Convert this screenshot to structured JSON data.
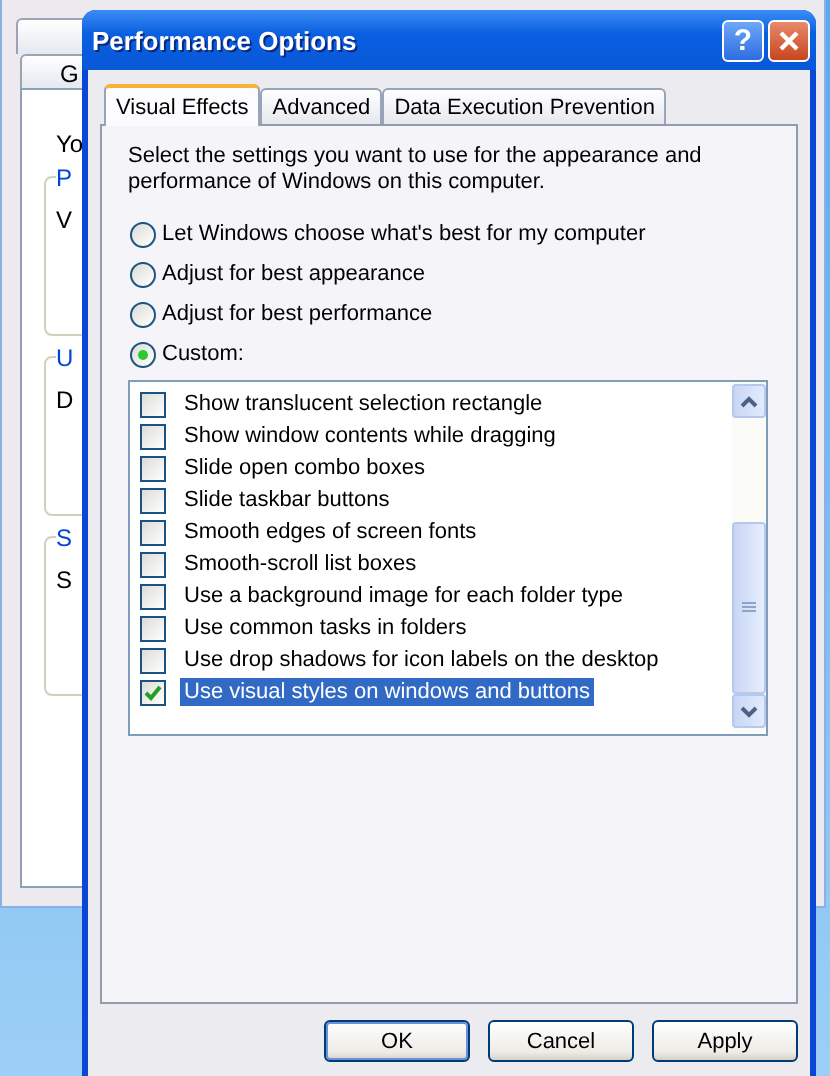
{
  "background_window": {
    "tab": "G",
    "intro": "Yo",
    "groups": [
      {
        "title": "P",
        "text": "V"
      },
      {
        "title": "U",
        "text": "D"
      },
      {
        "title": "S",
        "text": "S"
      }
    ]
  },
  "dialog": {
    "title": "Performance Options",
    "help_button": "?",
    "tabs": [
      {
        "label": "Visual Effects",
        "selected": true
      },
      {
        "label": "Advanced",
        "selected": false
      },
      {
        "label": "Data Execution Prevention",
        "selected": false
      }
    ],
    "description": "Select the settings you want to use for the appearance and performance of Windows on this computer.",
    "options": [
      {
        "label": "Let Windows choose what's best for my computer",
        "selected": false
      },
      {
        "label": "Adjust for best appearance",
        "selected": false
      },
      {
        "label": "Adjust for best performance",
        "selected": false
      },
      {
        "label": "Custom:",
        "selected": true
      }
    ],
    "effects": [
      {
        "label": "Show translucent selection rectangle",
        "checked": false,
        "selected": false
      },
      {
        "label": "Show window contents while dragging",
        "checked": false,
        "selected": false
      },
      {
        "label": "Slide open combo boxes",
        "checked": false,
        "selected": false
      },
      {
        "label": "Slide taskbar buttons",
        "checked": false,
        "selected": false
      },
      {
        "label": "Smooth edges of screen fonts",
        "checked": false,
        "selected": false
      },
      {
        "label": "Smooth-scroll list boxes",
        "checked": false,
        "selected": false
      },
      {
        "label": "Use a background image for each folder type",
        "checked": false,
        "selected": false
      },
      {
        "label": "Use common tasks in folders",
        "checked": false,
        "selected": false
      },
      {
        "label": "Use drop shadows for icon labels on the desktop",
        "checked": false,
        "selected": false
      },
      {
        "label": "Use visual styles on windows and buttons",
        "checked": true,
        "selected": true
      }
    ],
    "buttons": [
      "OK",
      "Cancel",
      "Apply"
    ]
  }
}
